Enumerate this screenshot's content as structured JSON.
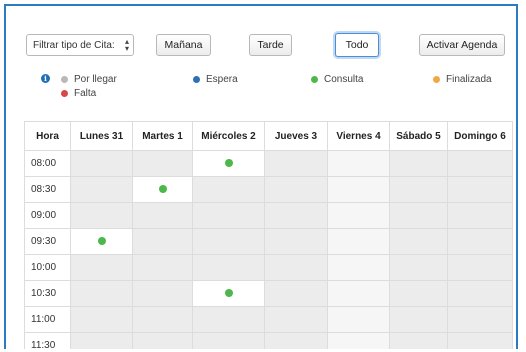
{
  "toolbar": {
    "filter": {
      "selected": "Filtrar tipo de Cita:",
      "options": [
        "Filtrar tipo de Cita:"
      ]
    },
    "buttons": {
      "manana": "Mañana",
      "tarde": "Tarde",
      "todo": "Todo",
      "activar": "Activar Agenda"
    },
    "active_button": "Todo"
  },
  "legend": [
    {
      "label": "Por llegar",
      "color": "#b9b9b9"
    },
    {
      "label": "Espera",
      "color": "#2e6fb5"
    },
    {
      "label": "Consulta",
      "color": "#4cb84a"
    },
    {
      "label": "Finalizada",
      "color": "#f0a845"
    },
    {
      "label": "Falta",
      "color": "#d9464a"
    }
  ],
  "calendar": {
    "headers": [
      "Hora",
      "Lunes 31",
      "Martes 1",
      "Miércoles 2",
      "Jueves 3",
      "Viernes 4",
      "Sábado 5",
      "Domingo 6"
    ],
    "rows": [
      {
        "time": "08:00",
        "events": [
          {
            "day": 3,
            "status": "Consulta",
            "color": "#4cb84a"
          }
        ]
      },
      {
        "time": "08:30",
        "events": [
          {
            "day": 2,
            "status": "Consulta",
            "color": "#4cb84a"
          }
        ]
      },
      {
        "time": "09:00",
        "events": []
      },
      {
        "time": "09:30",
        "events": [
          {
            "day": 1,
            "status": "Consulta",
            "color": "#4cb84a"
          }
        ]
      },
      {
        "time": "10:00",
        "events": []
      },
      {
        "time": "10:30",
        "events": [
          {
            "day": 3,
            "status": "Consulta",
            "color": "#4cb84a"
          }
        ]
      },
      {
        "time": "11:00",
        "events": []
      },
      {
        "time": "11:30",
        "events": []
      }
    ]
  }
}
